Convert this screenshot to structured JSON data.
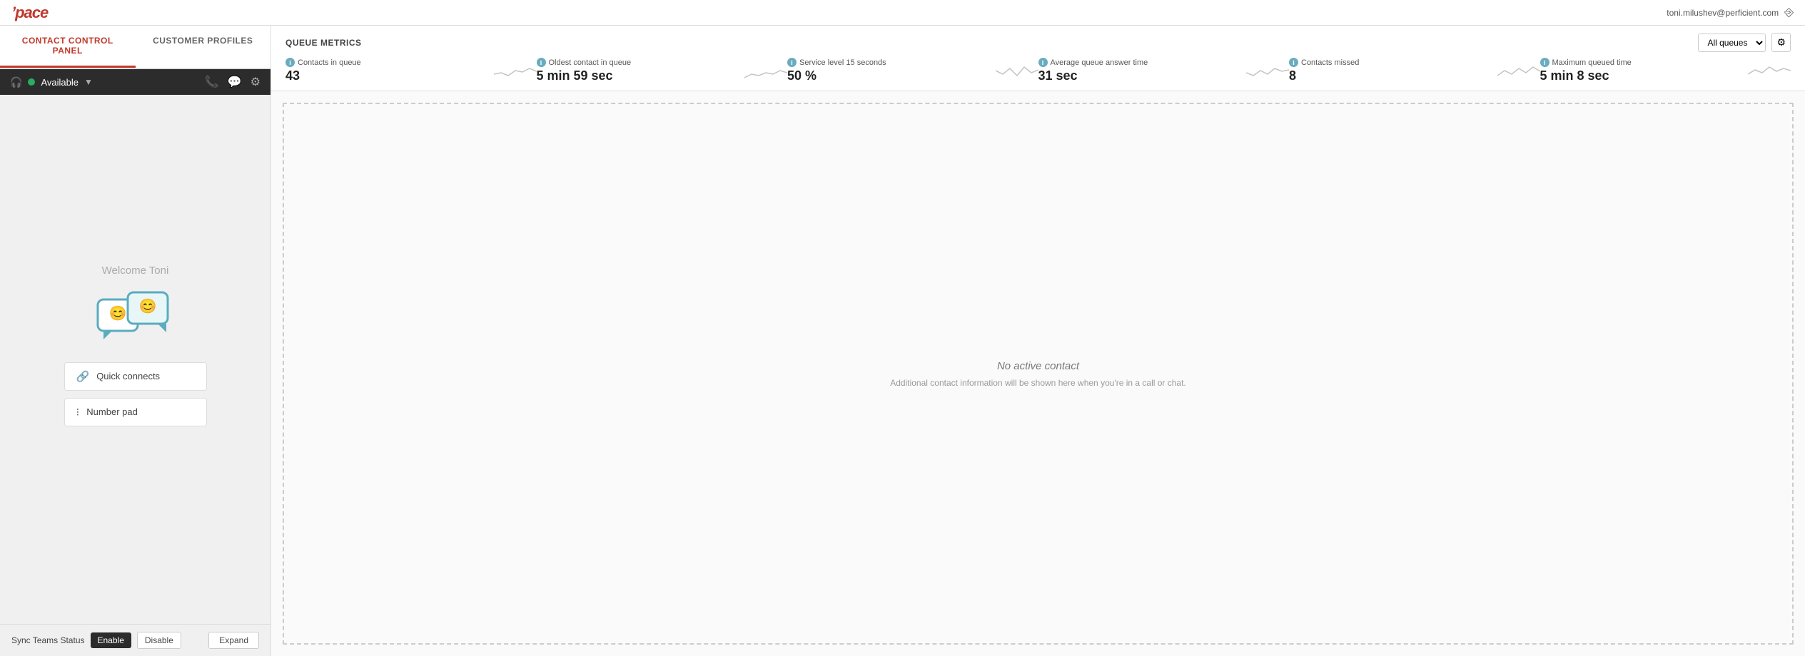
{
  "topbar": {
    "logo": "pace",
    "user_email": "toni.milushev@perficient.com",
    "logout_icon": "⎋"
  },
  "left_panel": {
    "tabs": [
      {
        "id": "contact-control-panel",
        "label": "CONTACT CONTROL PANEL",
        "active": true
      },
      {
        "id": "customer-profiles",
        "label": "CUSTOMER PROFILES",
        "active": false
      }
    ],
    "status": {
      "label": "Available",
      "dot_color": "#27ae60"
    },
    "icons": {
      "phone": "📞",
      "chat": "💬",
      "settings": "⚙"
    },
    "welcome_text": "Welcome Toni",
    "action_buttons": [
      {
        "id": "quick-connects",
        "icon": "🔗",
        "label": "Quick connects"
      },
      {
        "id": "number-pad",
        "icon": "⠿",
        "label": "Number pad"
      }
    ],
    "bottom": {
      "sync_label": "Sync Teams Status",
      "enable_label": "Enable",
      "disable_label": "Disable",
      "expand_label": "Expand"
    }
  },
  "queue_metrics": {
    "title": "QUEUE METRICS",
    "filter_label": "All queues",
    "settings_icon": "⚙",
    "metrics": [
      {
        "id": "contacts-in-queue",
        "label": "Contacts in queue",
        "value": "43"
      },
      {
        "id": "oldest-contact",
        "label": "Oldest contact in queue",
        "value": "5 min 59 sec"
      },
      {
        "id": "service-level",
        "label": "Service level 15 seconds",
        "value": "50 %"
      },
      {
        "id": "avg-answer-time",
        "label": "Average queue answer time",
        "value": "31 sec"
      },
      {
        "id": "contacts-missed",
        "label": "Contacts missed",
        "value": "8"
      },
      {
        "id": "max-queued-time",
        "label": "Maximum queued time",
        "value": "5 min 8 sec"
      }
    ]
  },
  "content_area": {
    "no_contact_title": "No active contact",
    "no_contact_sub": "Additional contact information will be shown here when you're in a call or chat."
  }
}
